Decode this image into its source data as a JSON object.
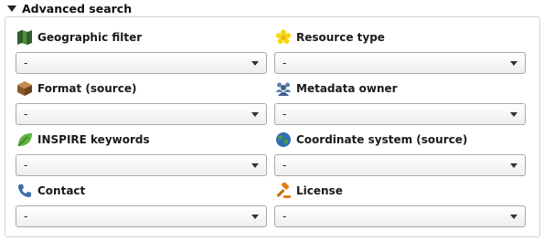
{
  "section": {
    "title": "Advanced search",
    "collapse_icon": "triangle-down-icon"
  },
  "fields": [
    {
      "label": "Geographic filter",
      "value": "-",
      "icon": "map-icon"
    },
    {
      "label": "Resource type",
      "value": "-",
      "icon": "flower-icon"
    },
    {
      "label": "Format (source)",
      "value": "-",
      "icon": "box-icon"
    },
    {
      "label": "Metadata owner",
      "value": "-",
      "icon": "group-icon"
    },
    {
      "label": "INSPIRE keywords",
      "value": "-",
      "icon": "leaf-icon"
    },
    {
      "label": "Coordinate system (source)",
      "value": "-",
      "icon": "globe-icon"
    },
    {
      "label": "Contact",
      "value": "-",
      "icon": "phone-icon"
    },
    {
      "label": "License",
      "value": "-",
      "icon": "gavel-icon"
    }
  ]
}
